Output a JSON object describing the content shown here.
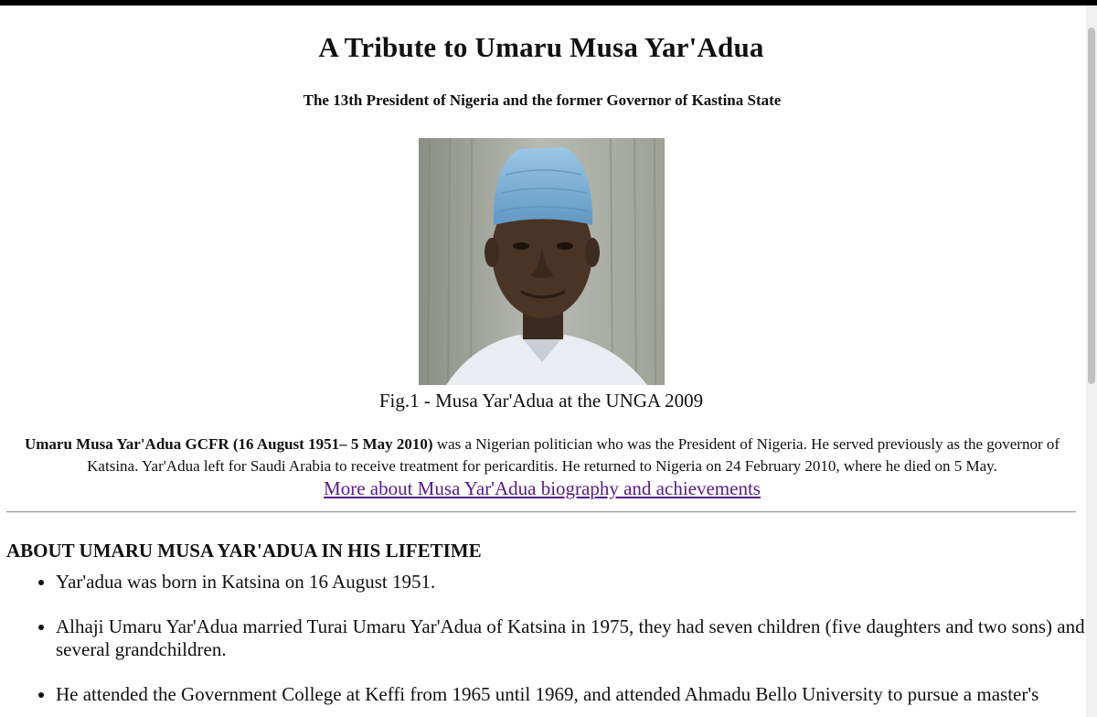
{
  "page": {
    "title": "A Tribute to Umaru Musa Yar'Adua",
    "subtitle": "The 13th President of Nigeria and the former Governor of Kastina State",
    "figure": {
      "caption": "Fig.1 - Musa Yar'Adua at the UNGA 2009"
    },
    "intro": {
      "bold": "Umaru Musa Yar'Adua GCFR (16 August 1951– 5 May 2010)",
      "text": " was a Nigerian politician who was the President of Nigeria. He served previously as the governor of Katsina. Yar'Adua left for Saudi Arabia to receive treatment for pericarditis. He returned to Nigeria on 24 February 2010, where he died on 5 May."
    },
    "more_link": "More about Musa Yar'Adua biography and achievements",
    "section_heading": "ABOUT UMARU MUSA YAR'ADUA IN HIS LIFETIME",
    "facts": [
      "Yar'adua was born in Katsina on 16 August 1951.",
      "Alhaji Umaru Yar'Adua married Turai Umaru Yar'Adua of Katsina in 1975, they had seven children (five daughters and two sons) and several grandchildren.",
      "He attended the Government College at Keffi from 1965 until 1969, and attended Ahmadu Bello University to pursue a master's"
    ]
  },
  "colors": {
    "link_visited": "#551a8b",
    "cap_blue": "#7fb3d8",
    "robe_white": "#e9edf2"
  }
}
